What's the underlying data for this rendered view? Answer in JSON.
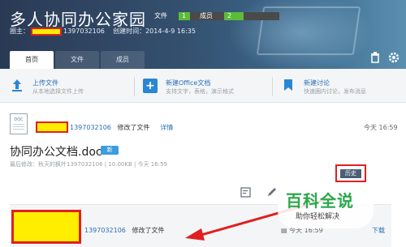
{
  "header": {
    "title": "多人协同办公家园",
    "stats": {
      "files_label": "文件",
      "files_value": "1",
      "files_fill": 0.2,
      "members_label": "成员",
      "members_value": "2",
      "members_fill": 0.35
    },
    "owner_label": "圈主：",
    "owner_id": "1397032106",
    "created_label": "创建时间：2014-4-9 16:35",
    "tabs": [
      "首页",
      "文件",
      "成员"
    ],
    "icons": {
      "trash": "trash-icon",
      "settings": "gear-icon"
    }
  },
  "actions": [
    {
      "name": "上传文件",
      "desc": "从本地选择文件上传",
      "icon": "upload-icon"
    },
    {
      "name": "新建Office文档",
      "desc": "支持文字，表格，演示格式",
      "icon": "plus-icon"
    },
    {
      "name": "新建讨论",
      "desc": "快速圈内讨论，发布消息",
      "icon": "bookmark-icon"
    }
  ],
  "feed": {
    "item1": {
      "doc_icon_label": "DOC",
      "user_id": "1397032106",
      "action": "修改了文件",
      "detail_link": "详情",
      "time": "今天 16:59",
      "doc_title": "协同办公文档.doc",
      "badge": "新",
      "meta": "最后修改：秋天的枫叶1397032106 | 10.00KB | 今天 16:59",
      "history_button": "历史"
    },
    "item2": {
      "user_id": "1397032106",
      "action": "修改了文件",
      "time": "今天 16:59",
      "download": "下载"
    }
  },
  "watermark": {
    "title": "百科全说",
    "subtitle": "助你轻松解决"
  },
  "colors": {
    "header_start": "#2a3a55",
    "header_end": "#5a8fb0",
    "accent_blue": "#2a6fb5",
    "highlight_red": "#e02020",
    "redaction_yellow": "#ffee00",
    "brand_green": "#2aa84a"
  }
}
